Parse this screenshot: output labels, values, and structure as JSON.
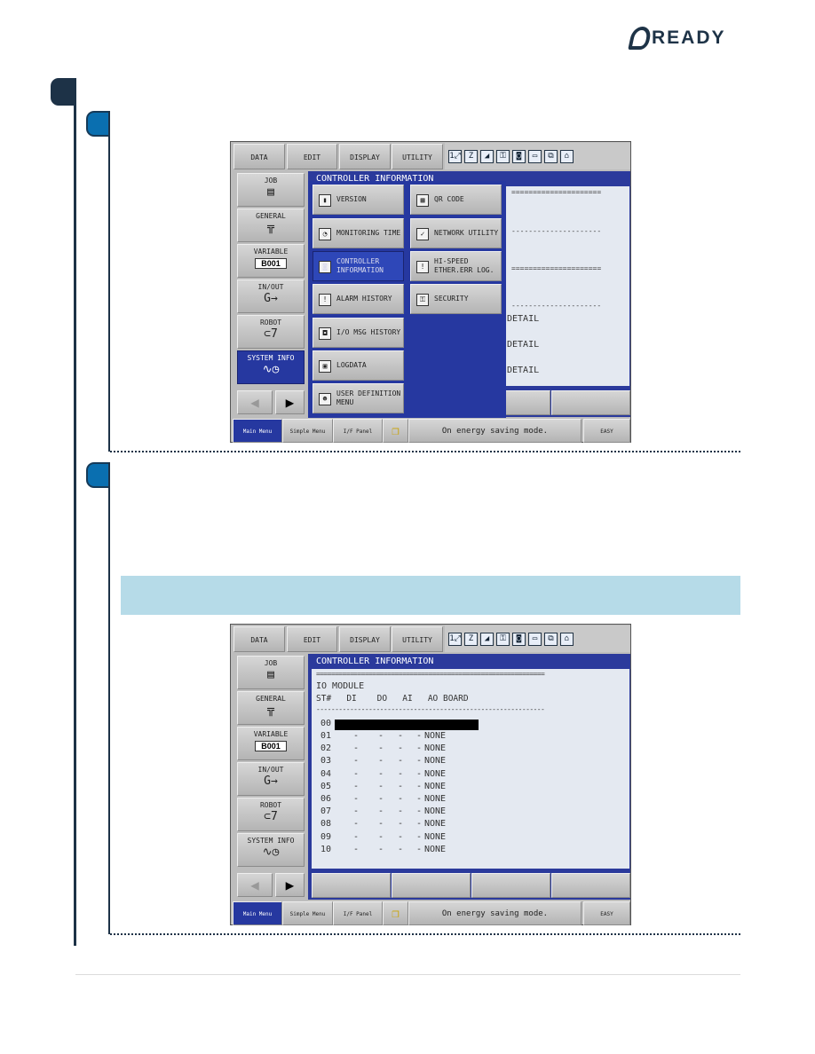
{
  "logo": {
    "text": "READY"
  },
  "screens": [
    {
      "menu": [
        "DATA",
        "EDIT",
        "DISPLAY",
        "UTILITY"
      ],
      "status_icons": [
        "speed-icon",
        "edit-icon",
        "signal-icon",
        "key-icon",
        "servo-icon",
        "screen-icon",
        "copy-icon",
        "robot-icon"
      ],
      "sidebar": [
        {
          "label": "JOB",
          "icon": "job-icon",
          "glyph": "▤"
        },
        {
          "label": "GENERAL",
          "icon": "general-icon",
          "glyph": "╦"
        },
        {
          "label": "VARIABLE",
          "icon": "variable-icon",
          "value": "B001"
        },
        {
          "label": "IN/OUT",
          "icon": "in-out-icon",
          "glyph": "G→"
        },
        {
          "label": "ROBOT",
          "icon": "robot-icon",
          "glyph": "⊂7"
        },
        {
          "label": "SYSTEM INFO",
          "icon": "system-info-icon",
          "glyph": "∿◷",
          "selected": true
        }
      ],
      "title": "CONTROLLER INFORMATION",
      "popup": {
        "left": [
          {
            "label": "VERSION",
            "icon": "version-icon",
            "glyph": "▮"
          },
          {
            "label": "MONITORING TIME",
            "icon": "monitoring-time-icon",
            "glyph": "◔"
          },
          {
            "label": "CONTROLLER INFORMATION",
            "icon": "controller-info-icon",
            "glyph": "◙",
            "selected": true
          },
          {
            "label": "ALARM HISTORY",
            "icon": "alarm-history-icon",
            "glyph": "!"
          },
          {
            "label": "I/O MSG HISTORY",
            "icon": "io-msg-history-icon",
            "glyph": "◘"
          },
          {
            "label": "LOGDATA",
            "icon": "logdata-icon",
            "glyph": "▣"
          },
          {
            "label": "USER DEFINITION MENU",
            "icon": "user-definition-icon",
            "glyph": "☻"
          }
        ],
        "right": [
          {
            "label": "QR CODE",
            "icon": "qr-code-icon",
            "glyph": "▦"
          },
          {
            "label": "NETWORK UTILITY",
            "icon": "network-utility-icon",
            "glyph": "✓"
          },
          {
            "label": "HI-SPEED ETHER.ERR LOG.",
            "icon": "hi-speed-error-icon",
            "glyph": "!"
          },
          {
            "label": "SECURITY",
            "icon": "security-key-icon",
            "glyph": "⚿"
          }
        ]
      },
      "background_lines": [
        "=====================",
        "---------------------",
        "=====================",
        "---------------------",
        "DETAIL",
        "DETAIL",
        "DETAIL"
      ],
      "status_bar": {
        "main_menu": "Main Menu",
        "simple_menu": "Simple Menu",
        "if_panel": "I/F Panel",
        "message": "On energy saving mode.",
        "mode": "EASY"
      }
    },
    {
      "menu": [
        "DATA",
        "EDIT",
        "DISPLAY",
        "UTILITY"
      ],
      "status_icons": [
        "speed-icon",
        "edit-icon",
        "signal-icon",
        "key-icon",
        "servo-icon",
        "screen-icon",
        "copy-icon",
        "robot-icon"
      ],
      "sidebar": [
        {
          "label": "JOB",
          "icon": "job-icon",
          "glyph": "▤"
        },
        {
          "label": "GENERAL",
          "icon": "general-icon",
          "glyph": "╦"
        },
        {
          "label": "VARIABLE",
          "icon": "variable-icon",
          "value": "B001"
        },
        {
          "label": "IN/OUT",
          "icon": "in-out-icon",
          "glyph": "G→"
        },
        {
          "label": "ROBOT",
          "icon": "robot-icon",
          "glyph": "⊂7"
        },
        {
          "label": "SYSTEM INFO",
          "icon": "system-info-icon",
          "glyph": "∿◷"
        }
      ],
      "title": "CONTROLLER INFORMATION",
      "io_module": {
        "separator_top": "=============================================================",
        "heading": "IO MODULE",
        "columns": "ST#   DI    DO   AI   AO BOARD",
        "separator": "-------------------------------------------------------------",
        "highlighted_row": "00",
        "rows": [
          {
            "st": "01",
            "di": "-",
            "do": "-",
            "ai": "-",
            "ao": "-",
            "board": "NONE"
          },
          {
            "st": "02",
            "di": "-",
            "do": "-",
            "ai": "-",
            "ao": "-",
            "board": "NONE"
          },
          {
            "st": "03",
            "di": "-",
            "do": "-",
            "ai": "-",
            "ao": "-",
            "board": "NONE"
          },
          {
            "st": "04",
            "di": "-",
            "do": "-",
            "ai": "-",
            "ao": "-",
            "board": "NONE"
          },
          {
            "st": "05",
            "di": "-",
            "do": "-",
            "ai": "-",
            "ao": "-",
            "board": "NONE"
          },
          {
            "st": "06",
            "di": "-",
            "do": "-",
            "ai": "-",
            "ao": "-",
            "board": "NONE"
          },
          {
            "st": "07",
            "di": "-",
            "do": "-",
            "ai": "-",
            "ao": "-",
            "board": "NONE"
          },
          {
            "st": "08",
            "di": "-",
            "do": "-",
            "ai": "-",
            "ao": "-",
            "board": "NONE"
          },
          {
            "st": "09",
            "di": "-",
            "do": "-",
            "ai": "-",
            "ao": "-",
            "board": "NONE"
          },
          {
            "st": "10",
            "di": "-",
            "do": "-",
            "ai": "-",
            "ao": "-",
            "board": "NONE"
          }
        ]
      },
      "status_bar": {
        "main_menu": "Main Menu",
        "simple_menu": "Simple Menu",
        "if_panel": "I/F Panel",
        "message": "On energy saving mode.",
        "mode": "EASY"
      }
    }
  ]
}
